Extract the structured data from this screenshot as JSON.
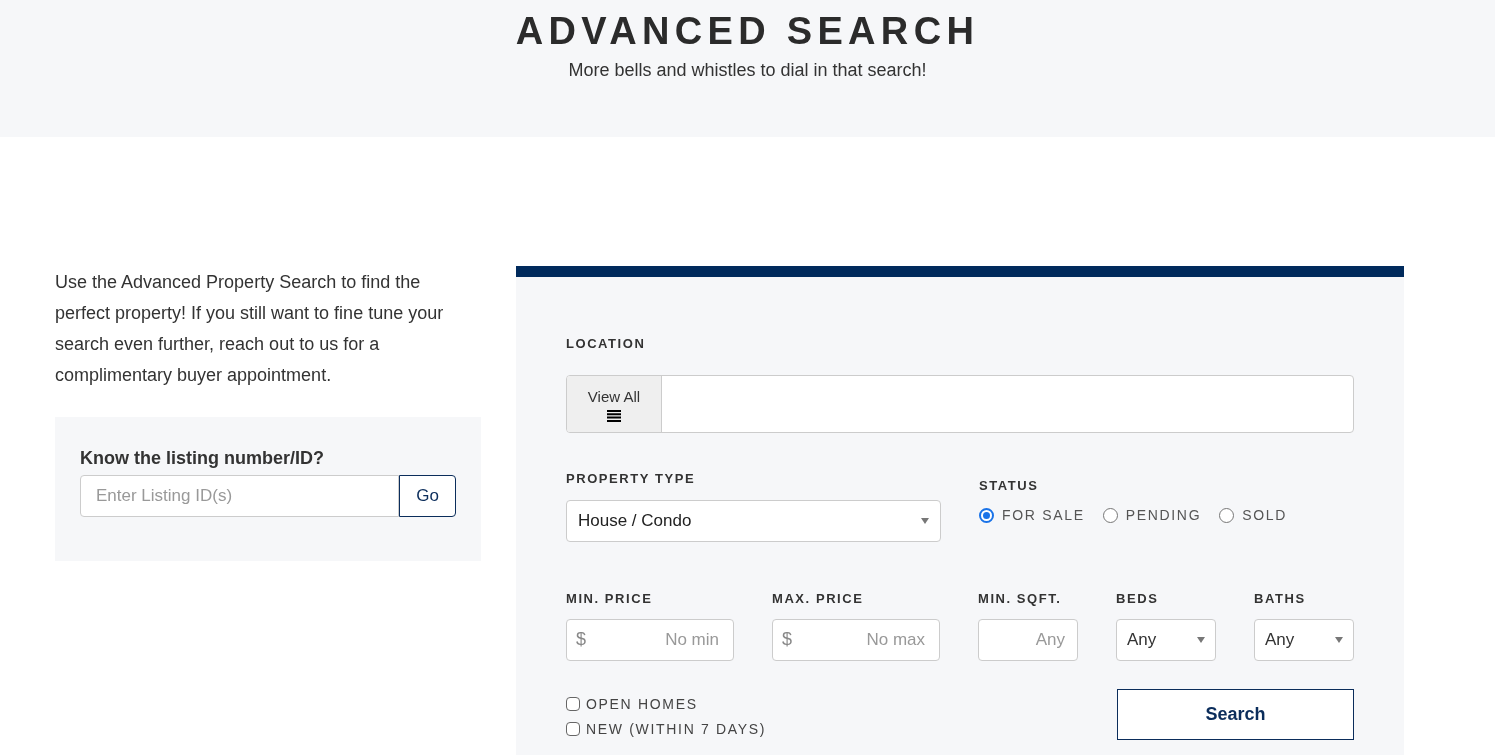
{
  "header": {
    "title": "ADVANCED SEARCH",
    "subtitle": "More bells and whistles to dial in that search!"
  },
  "intro": "Use the Advanced Property Search to find the perfect property! If you still want to fine tune your search even further, reach out to us for a complimentary buyer appointment.",
  "listing_box": {
    "heading": "Know the listing number/ID?",
    "placeholder": "Enter Listing ID(s)",
    "button": "Go"
  },
  "search_form": {
    "location": {
      "label": "LOCATION",
      "view_all": "View All"
    },
    "property_type": {
      "label": "PROPERTY TYPE",
      "value": "House / Condo"
    },
    "status": {
      "label": "STATUS",
      "options": [
        {
          "label": "FOR SALE",
          "selected": true
        },
        {
          "label": "PENDING",
          "selected": false
        },
        {
          "label": "SOLD",
          "selected": false
        }
      ]
    },
    "fields": [
      {
        "kind": "price",
        "label": "MIN. PRICE",
        "prefix": "$",
        "placeholder": "No min"
      },
      {
        "kind": "price",
        "label": "MAX. PRICE",
        "prefix": "$",
        "placeholder": "No max"
      },
      {
        "kind": "text",
        "label": "MIN. SQFT.",
        "placeholder": "Any"
      },
      {
        "kind": "select",
        "label": "BEDS",
        "value": "Any"
      },
      {
        "kind": "select",
        "label": "BATHS",
        "value": "Any"
      }
    ],
    "checkboxes": [
      {
        "label": "OPEN HOMES",
        "checked": false
      },
      {
        "label": "NEW (WITHIN 7 DAYS)",
        "checked": false
      }
    ],
    "search_button": "Search"
  }
}
